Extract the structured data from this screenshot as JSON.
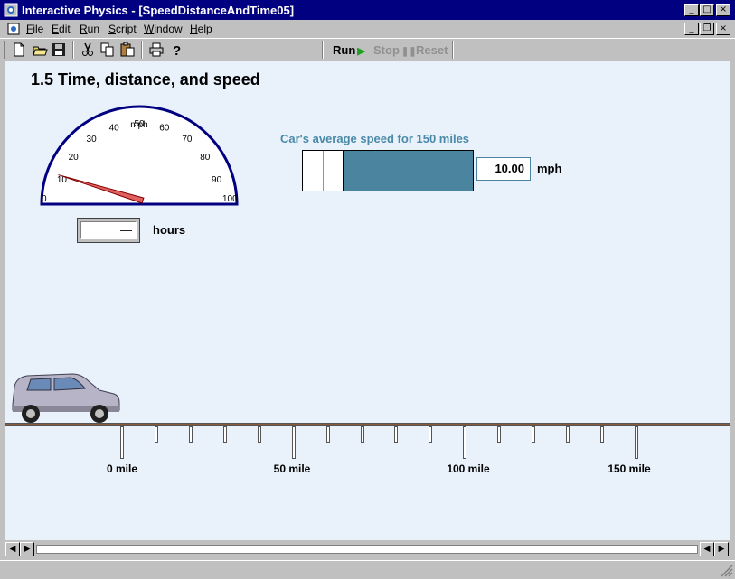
{
  "window": {
    "title": "Interactive Physics - [SpeedDistanceAndTime05]",
    "controls": {
      "minimize": "_",
      "maximize": "□",
      "close": "×"
    },
    "doc_controls": {
      "minimize": "_",
      "restore": "❐",
      "close": "×"
    }
  },
  "menu": {
    "items": [
      {
        "label": "File",
        "key": "F",
        "rest": "ile"
      },
      {
        "label": "Edit",
        "key": "E",
        "rest": "dit"
      },
      {
        "label": "Run",
        "key": "R",
        "rest": "un"
      },
      {
        "label": "Script",
        "key": "S",
        "rest": "cript"
      },
      {
        "label": "Window",
        "key": "W",
        "rest": "indow"
      },
      {
        "label": "Help",
        "key": "H",
        "rest": "elp"
      }
    ]
  },
  "toolbar": {
    "icons": [
      "new-file-icon",
      "open-folder-icon",
      "save-disk-icon",
      "cut-scissors-icon",
      "copy-icon",
      "paste-icon",
      "print-icon",
      "help-question-icon"
    ],
    "run_label": "Run",
    "stop_label": "Stop",
    "reset_label": "Reset"
  },
  "scene": {
    "heading": "1.5 Time, distance, and speed",
    "speedometer": {
      "ticks": [
        "0",
        "10",
        "20",
        "30",
        "40",
        "50",
        "60",
        "70",
        "80",
        "90",
        "100"
      ],
      "unit": "mph",
      "reading_mph": 10
    },
    "hours": {
      "value": "—",
      "label": "hours"
    },
    "avg_speed": {
      "title": "Car's average speed for 150 miles",
      "value": "10.00",
      "unit": "mph",
      "colors": {
        "bar": "#4a849f",
        "title": "#4a8aa8"
      }
    },
    "road": {
      "labels": [
        "0 mile",
        "50 mile",
        "100 mile",
        "150 mile"
      ],
      "color": "#8a5a3a"
    }
  }
}
